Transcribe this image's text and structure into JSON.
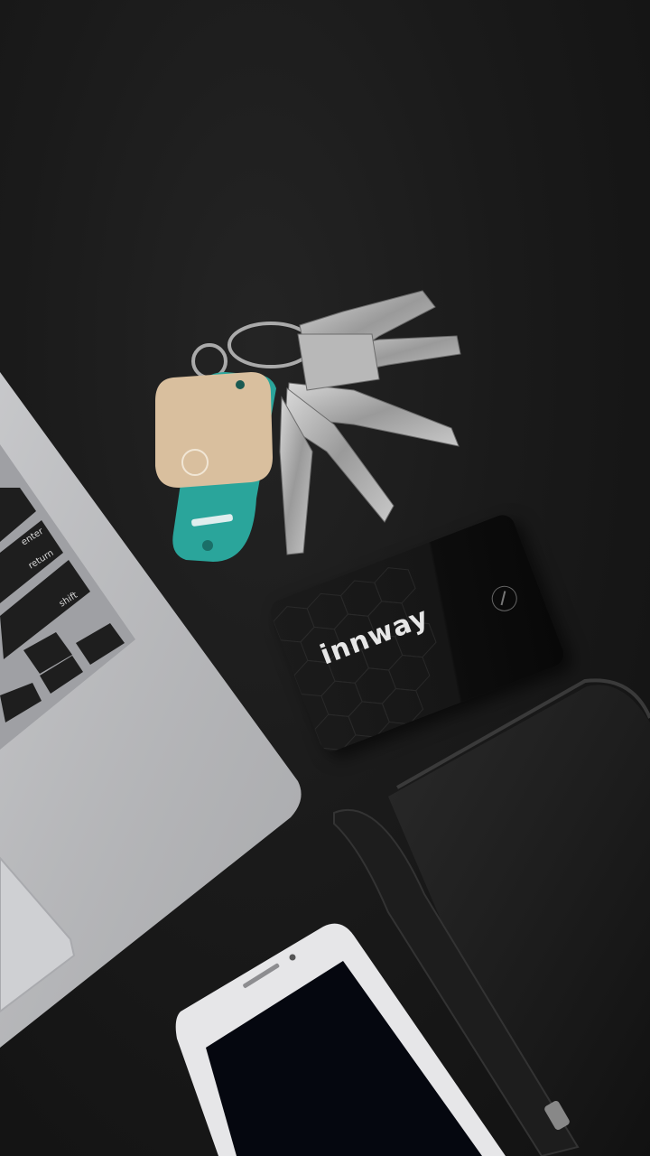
{
  "scene": {
    "description_labels": {
      "card_brand": "innway",
      "key_enter": "enter",
      "key_return": "return",
      "key_shift": "shift"
    },
    "colors": {
      "background": "#161616",
      "tracker": "#d9bf9e",
      "keytag": "#2aa59b",
      "laptop": "#c7c7c9",
      "phone": "#e6e6e8"
    }
  }
}
